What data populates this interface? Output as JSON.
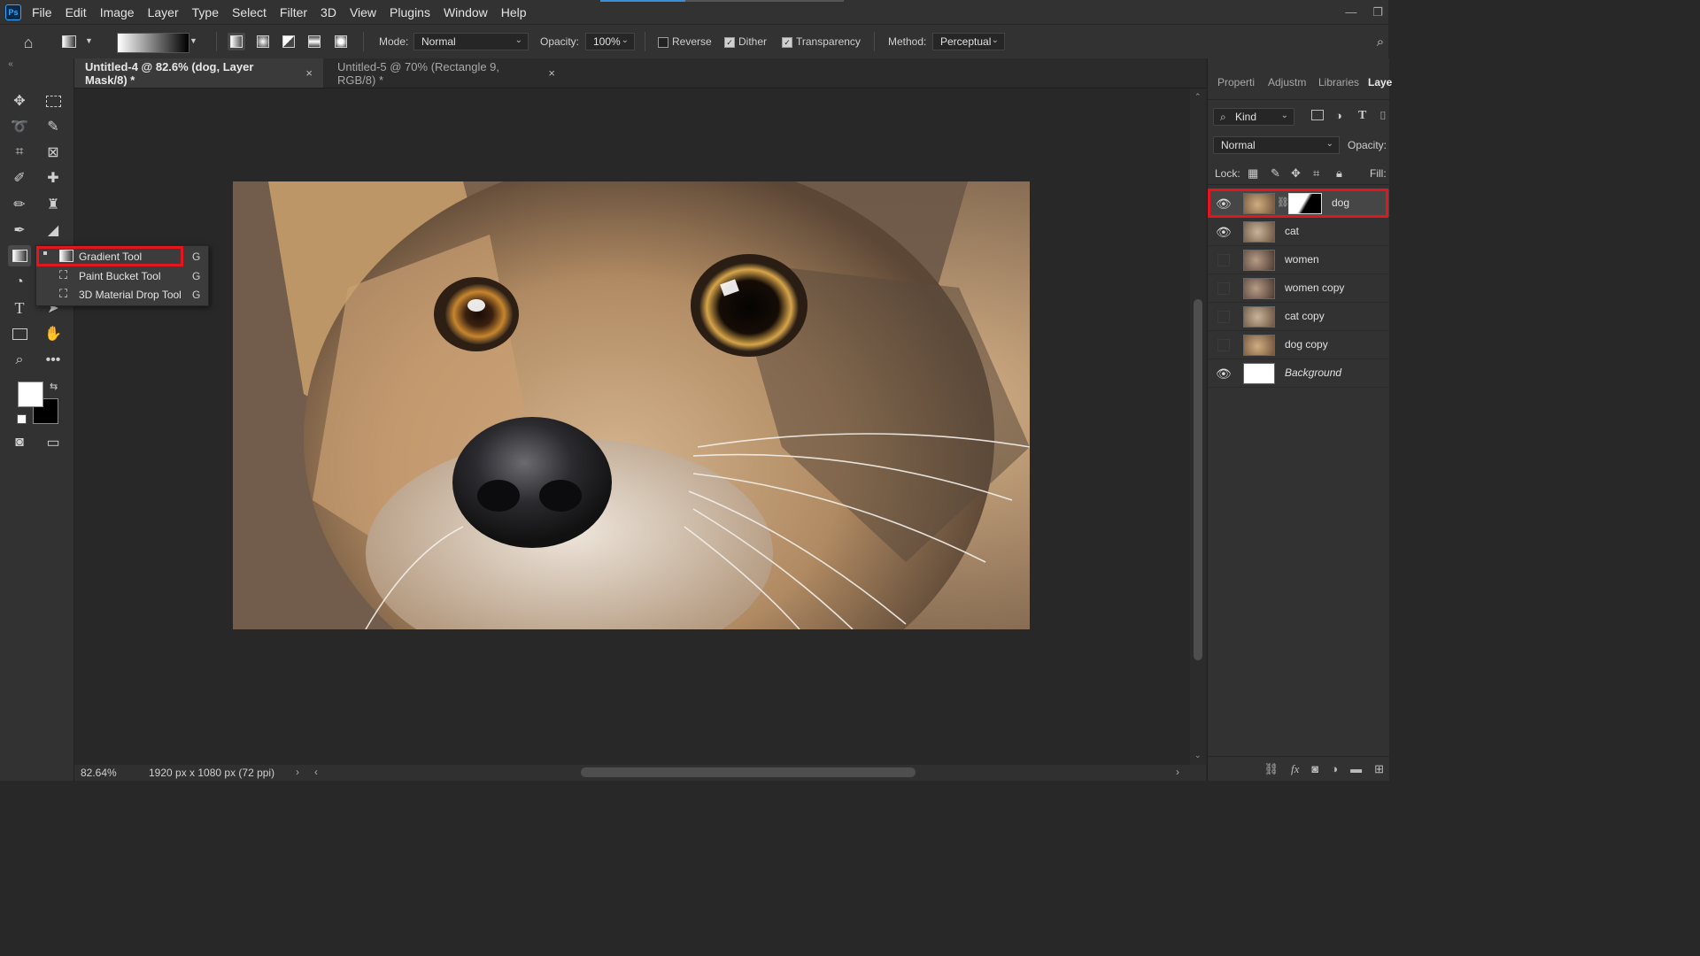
{
  "app": {
    "logo": "Ps"
  },
  "menu": [
    "File",
    "Edit",
    "Image",
    "Layer",
    "Type",
    "Select",
    "Filter",
    "3D",
    "View",
    "Plugins",
    "Window",
    "Help"
  ],
  "loading_progress": 0.35,
  "options_bar": {
    "mode_label": "Mode:",
    "mode_value": "Normal",
    "opacity_label": "Opacity:",
    "opacity_value": "100%",
    "reverse_label": "Reverse",
    "reverse_checked": false,
    "dither_label": "Dither",
    "dither_checked": true,
    "transparency_label": "Transparency",
    "transparency_checked": true,
    "method_label": "Method:",
    "method_value": "Perceptual"
  },
  "tabs": [
    {
      "title": "Untitled-4 @ 82.6% (dog, Layer Mask/8) *",
      "active": true
    },
    {
      "title": "Untitled-5 @ 70% (Rectangle 9, RGB/8) *",
      "active": false
    }
  ],
  "flyout": {
    "items": [
      {
        "label": "Gradient Tool",
        "shortcut": "G",
        "selected": true,
        "icon": "gradient-icon"
      },
      {
        "label": "Paint Bucket Tool",
        "shortcut": "G",
        "selected": false,
        "icon": "paint-bucket-icon"
      },
      {
        "label": "3D Material Drop Tool",
        "shortcut": "G",
        "selected": false,
        "icon": "3d-material-drop-icon"
      }
    ]
  },
  "status": {
    "zoom": "82.64%",
    "doc_info": "1920 px x 1080 px (72 ppi)"
  },
  "panel": {
    "tabs": [
      "Properti",
      "Adjustm",
      "Libraries",
      "Laye"
    ],
    "kind_filter": "Kind",
    "blend_mode": "Normal",
    "opacity_label": "Opacity:",
    "lock_label": "Lock:",
    "fill_label": "Fill:",
    "layers": [
      {
        "name": "dog",
        "visible": true,
        "selected": true,
        "has_mask": true
      },
      {
        "name": "cat",
        "visible": true,
        "selected": false
      },
      {
        "name": "women",
        "visible": false,
        "selected": false
      },
      {
        "name": "women copy",
        "visible": false,
        "selected": false
      },
      {
        "name": "cat copy",
        "visible": false,
        "selected": false
      },
      {
        "name": "dog copy",
        "visible": false,
        "selected": false
      },
      {
        "name": "Background",
        "visible": true,
        "selected": false,
        "italic": true
      }
    ]
  },
  "colors": {
    "accent_red": "#e3161f",
    "ps_blue": "#31a8ff"
  }
}
